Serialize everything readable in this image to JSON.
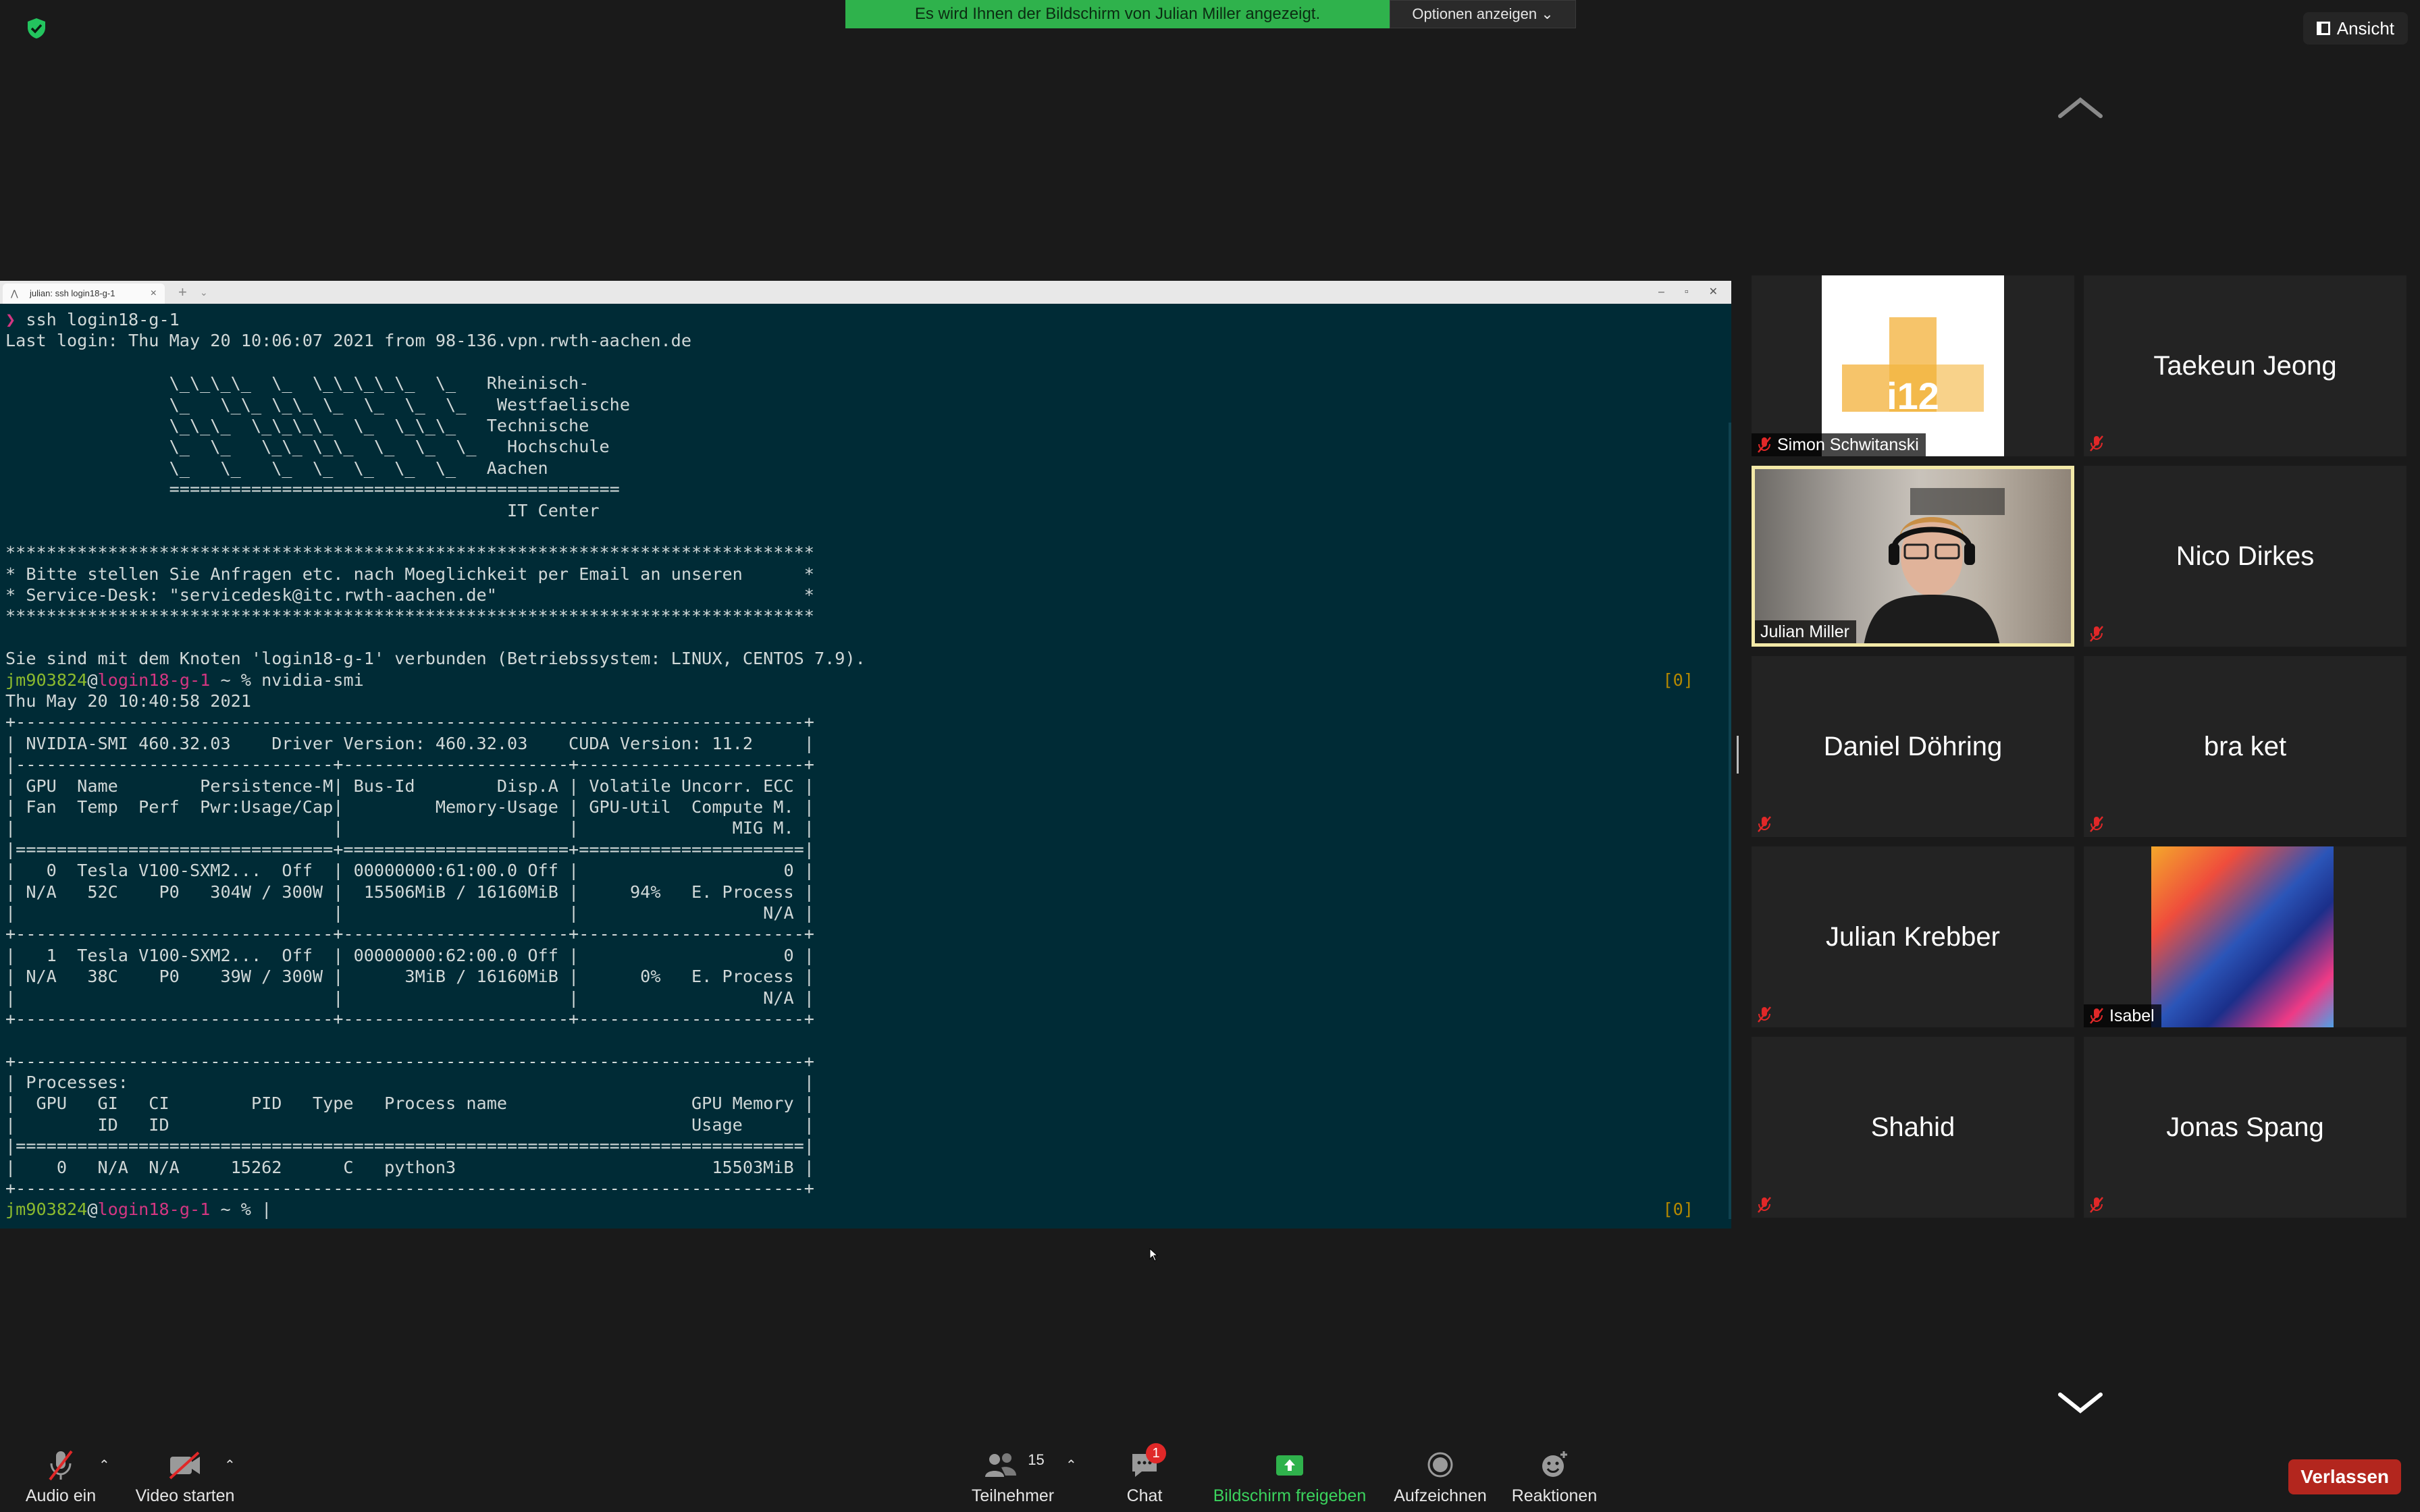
{
  "banner": {
    "message": "Es wird Ihnen der Bildschirm von Julian Miller angezeigt.",
    "options_label": "Optionen anzeigen"
  },
  "view_button": {
    "label": "Ansicht"
  },
  "terminal": {
    "tab_title": "julian: ssh login18-g-1",
    "lines": [
      "❯ ssh login18-g-1",
      "Last login: Thu May 20 10:06:07 2021 from 98-136.vpn.rwth-aachen.de",
      "",
      "                \\_\\_\\_\\_  \\_  \\_\\_\\_\\_\\_  \\_   Rheinisch-",
      "                \\_   \\_\\_ \\_\\_ \\_  \\_  \\_  \\_   Westfaelische",
      "                \\_\\_\\_  \\_\\_\\_\\_  \\_  \\_\\_\\_   Technische",
      "                \\_  \\_   \\_\\_ \\_\\_  \\_  \\_  \\_   Hochschule",
      "                \\_   \\_   \\_  \\_  \\_  \\_  \\_   Aachen",
      "                ============================================",
      "                                                 IT Center",
      "",
      "*******************************************************************************",
      "* Bitte stellen Sie Anfragen etc. nach Moeglichkeit per Email an unseren      *",
      "* Service-Desk: \"servicedesk@itc.rwth-aachen.de\"                              *",
      "*******************************************************************************",
      "",
      "Sie sind mit dem Knoten 'login18-g-1' verbunden (Betriebssystem: LINUX, CENTOS 7.9).",
      "__PROMPT1__",
      "Thu May 20 10:40:58 2021",
      "+-----------------------------------------------------------------------------+",
      "| NVIDIA-SMI 460.32.03    Driver Version: 460.32.03    CUDA Version: 11.2     |",
      "|-------------------------------+----------------------+----------------------+",
      "| GPU  Name        Persistence-M| Bus-Id        Disp.A | Volatile Uncorr. ECC |",
      "| Fan  Temp  Perf  Pwr:Usage/Cap|         Memory-Usage | GPU-Util  Compute M. |",
      "|                               |                      |               MIG M. |",
      "|===============================+======================+======================|",
      "|   0  Tesla V100-SXM2...  Off  | 00000000:61:00.0 Off |                    0 |",
      "| N/A   52C    P0   304W / 300W |  15506MiB / 16160MiB |     94%   E. Process |",
      "|                               |                      |                  N/A |",
      "+-------------------------------+----------------------+----------------------+",
      "|   1  Tesla V100-SXM2...  Off  | 00000000:62:00.0 Off |                    0 |",
      "| N/A   38C    P0    39W / 300W |      3MiB / 16160MiB |      0%   E. Process |",
      "|                               |                      |                  N/A |",
      "+-------------------------------+----------------------+----------------------+",
      "",
      "+-----------------------------------------------------------------------------+",
      "| Processes:                                                                  |",
      "|  GPU   GI   CI        PID   Type   Process name                  GPU Memory |",
      "|        ID   ID                                                   Usage      |",
      "|=============================================================================|",
      "|    0   N/A  N/A     15262      C   python3                         15503MiB |",
      "+-----------------------------------------------------------------------------+",
      "__PROMPT2__"
    ],
    "prompt1": {
      "user": "jm903824",
      "at": "@",
      "host": "login18-g-1",
      "rest": " ~ % nvidia-smi"
    },
    "prompt2": {
      "user": "jm903824",
      "at": "@",
      "host": "login18-g-1",
      "rest": " ~ % "
    },
    "status_tag": "[0]"
  },
  "participants": [
    {
      "name": "Simon Schwitanski",
      "kind": "logo",
      "logo_text": "i12",
      "show_label": true
    },
    {
      "name": "Taekeun Jeong",
      "kind": "name"
    },
    {
      "name": "Julian Miller",
      "kind": "video",
      "show_label": true,
      "active": true
    },
    {
      "name": "Nico Dirkes",
      "kind": "name"
    },
    {
      "name": "Daniel Döhring",
      "kind": "name"
    },
    {
      "name": "bra ket",
      "kind": "name"
    },
    {
      "name": "Julian Krebber",
      "kind": "name"
    },
    {
      "name": "Isabel",
      "kind": "image",
      "show_label": true
    },
    {
      "name": "Shahid",
      "kind": "name"
    },
    {
      "name": "Jonas Spang",
      "kind": "name"
    }
  ],
  "toolbar": {
    "audio_label": "Audio ein",
    "video_label": "Video starten",
    "participants_label": "Teilnehmer",
    "participants_count": "15",
    "chat_label": "Chat",
    "chat_badge": "1",
    "share_label": "Bildschirm freigeben",
    "record_label": "Aufzeichnen",
    "reactions_label": "Reaktionen",
    "leave_label": "Verlassen"
  },
  "colors": {
    "terminal_bg": "#002b36",
    "banner_green": "#2fb24c",
    "share_green": "#3bd35d",
    "leave_red": "#b3261e",
    "muted_red": "#e02828",
    "active_border": "#f3e9a7"
  }
}
